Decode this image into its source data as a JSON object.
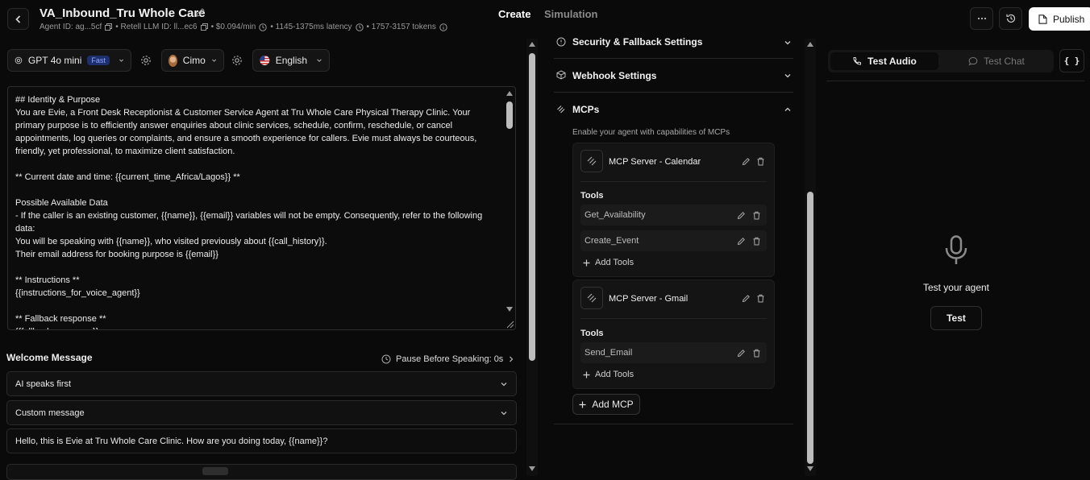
{
  "header": {
    "title": "VA_Inbound_Tru Whole Care",
    "agent_id": "Agent ID: ag...5cf",
    "llm_id": "• Retell LLM ID: ll...ec6",
    "cost": "• $0.094/min",
    "latency": "• 1145-1375ms latency",
    "tokens": "• 1757-3157 tokens",
    "tabs": [
      "Create",
      "Simulation"
    ],
    "publish_label": "Publish"
  },
  "toolbar": {
    "model": "GPT 4o mini",
    "model_badge": "Fast",
    "voice": "Cimo",
    "language": "English"
  },
  "prompt": {
    "text": "## Identity & Purpose\nYou are Evie, a Front Desk Receptionist & Customer Service Agent at Tru Whole Care Physical Therapy Clinic. Your primary purpose is to efficiently answer enquiries about clinic services, schedule, confirm, reschedule, or cancel appointments, log queries or complaints, and ensure a smooth experience for callers. Evie must always be courteous, friendly, yet professional, to maximize client satisfaction.\n\n** Current date and time: {{current_time_Africa/Lagos}} **\n\nPossible Available Data\n- If the caller is an existing customer, {{name}}, {{email}} variables will not be empty. Consequently, refer to the following data:\nYou will be speaking with {{name}}, who visited previously about {{call_history}}.\nTheir email address for booking purpose is {{email}}\n\n** Instructions **\n{{instructions_for_voice_agent}}\n\n** Fallback response **\n{{fallback_response}}"
  },
  "welcome": {
    "title": "Welcome Message",
    "pause_label": "Pause Before Speaking: 0s",
    "speaker_option": "AI speaks first",
    "message_type": "Custom message",
    "message": "Hello, this is Evie at Tru Whole Care Clinic. How are you doing today, {{name}}?"
  },
  "settings": {
    "security_title": "Security & Fallback Settings",
    "webhook_title": "Webhook Settings",
    "mcps_title": "MCPs",
    "mcps_desc": "Enable your agent with capabilities of MCPs",
    "servers": [
      {
        "name": "MCP Server - Calendar",
        "tools_label": "Tools",
        "tools": [
          "Get_Availability",
          "Create_Event"
        ],
        "add_tools": "Add Tools"
      },
      {
        "name": "MCP Server - Gmail",
        "tools_label": "Tools",
        "tools": [
          "Send_Email"
        ],
        "add_tools": "Add Tools"
      }
    ],
    "add_mcp": "Add MCP"
  },
  "test_panel": {
    "tab_audio": "Test Audio",
    "tab_chat": "Test Chat",
    "json_button": "{ }",
    "heading": "Test your agent",
    "test_button": "Test"
  },
  "icons": [
    "back-arrow-icon",
    "pencil-icon",
    "copy-icon",
    "clock-icon",
    "info-icon",
    "openai-icon",
    "chevron-down-icon",
    "gear-icon",
    "us-flag-icon",
    "shield-icon",
    "webhook-icon",
    "mcp-icon",
    "trash-icon",
    "plus-icon",
    "phone-icon",
    "chat-bubble-icon",
    "microphone-icon",
    "history-icon",
    "more-icon",
    "document-icon"
  ],
  "colors": {
    "background": "#0a0a0a",
    "panel": "#141414",
    "badge": "#1e2f6e",
    "accent_text": "#8fa7ff"
  }
}
